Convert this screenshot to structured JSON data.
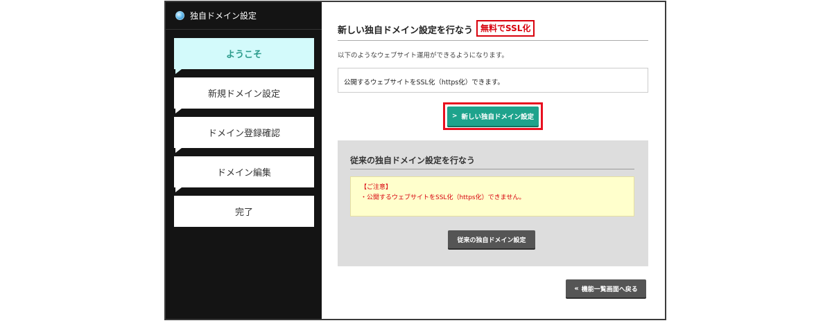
{
  "sidebar": {
    "title": "独自ドメイン設定",
    "icon": "globe-icon",
    "steps": [
      {
        "label": "ようこそ",
        "active": true
      },
      {
        "label": "新規ドメイン設定"
      },
      {
        "label": "ドメイン登録確認"
      },
      {
        "label": "ドメイン編集"
      },
      {
        "label": "完了"
      }
    ]
  },
  "main": {
    "section_title": "新しい独自ドメイン設定を行なう",
    "ssl_badge": "無料でSSL化",
    "intro": "以下のようなウェブサイト運用ができるようになります。",
    "info": "公開するウェブサイトをSSL化（https化）できます。",
    "primary_button": "新しい独自ドメイン設定",
    "legacy": {
      "title": "従来の独自ドメイン設定を行なう",
      "notice_heading": "【ご注意】",
      "notice_text": "・公開するウェブサイトをSSL化（https化）できません。",
      "button": "従来の独自ドメイン設定"
    },
    "back_button": "機能一覧画面へ戻る"
  },
  "colors": {
    "primary": "#1ea38c",
    "highlight": "#e8101f",
    "active_step_bg": "#d3fafb",
    "notice_bg": "#ffffcc",
    "sidebar_bg": "#141414"
  }
}
